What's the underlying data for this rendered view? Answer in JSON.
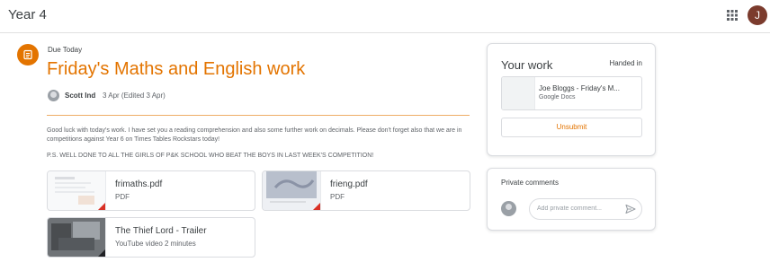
{
  "header": {
    "class_title": "Year 4",
    "apps_icon": "apps-grid-icon",
    "avatar_letter": "J"
  },
  "assignment": {
    "icon": "assignment-icon",
    "due": "Due Today",
    "title": "Friday's Maths and English work",
    "author": "Scott Ind",
    "date": "3 Apr (Edited 3 Apr)",
    "body": "Good luck with today's work. I have set you a reading comprehension and also some further work on decimals. Please don't forget also that we are in competitions against Year 6 on Times Tables Rockstars today!",
    "ps": "P.S. WELL DONE TO ALL THE GIRLS OF P&K SCHOOL WHO BEAT THE BOYS IN LAST WEEK'S COMPETITION!",
    "attachments": [
      {
        "name": "frimaths.pdf",
        "type": "PDF"
      },
      {
        "name": "frieng.pdf",
        "type": "PDF"
      },
      {
        "name": "The Thief Lord - Trailer",
        "type": "YouTube video  2 minutes"
      }
    ]
  },
  "your_work": {
    "title": "Your work",
    "status": "Handed in",
    "file_name": "Joe Bloggs - Friday's M...",
    "file_type": "Google Docs",
    "unsubmit_label": "Unsubmit"
  },
  "private_comments": {
    "title": "Private comments",
    "placeholder": "Add private comment...",
    "send_icon": "send-icon"
  },
  "colors": {
    "accent": "#e37400",
    "avatar": "#7b3b2d"
  }
}
